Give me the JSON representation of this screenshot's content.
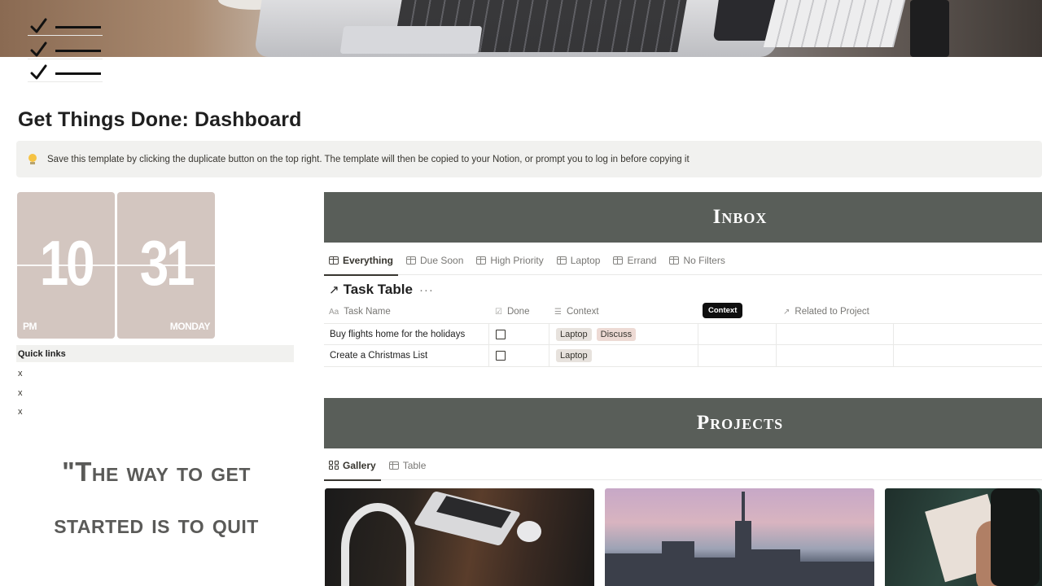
{
  "page": {
    "title": "Get Things Done: Dashboard",
    "callout": "Save this template by clicking the duplicate button on the top right. The template will then be copied to your Notion, or prompt you to log in before copying it"
  },
  "clock": {
    "hour": "10",
    "minute": "31",
    "period": "PM",
    "day": "MONDAY"
  },
  "quick_links": {
    "title": "Quick links",
    "items": [
      "x",
      "x",
      "x"
    ]
  },
  "quote": {
    "text": "\"The way to get started is to quit"
  },
  "inbox": {
    "banner": "Inbox",
    "tabs": [
      "Everything",
      "Due Soon",
      "High Priority",
      "Laptop",
      "Errand",
      "No Filters"
    ],
    "database_title": "Task Table",
    "columns": {
      "task_name": "Task Name",
      "done": "Done",
      "context": "Context",
      "related": "Related to Project"
    },
    "tooltip": "Context",
    "rows": [
      {
        "name": "Buy flights home for the holidays",
        "tags": [
          "Laptop",
          "Discuss"
        ]
      },
      {
        "name": "Create a Christmas List",
        "tags": [
          "Laptop"
        ]
      }
    ]
  },
  "projects": {
    "banner": "Projects",
    "tabs": [
      "Gallery",
      "Table"
    ]
  },
  "colors": {
    "banner": "#595e59",
    "clock_card": "#d3c6c0",
    "callout_bg": "#f1f1ef",
    "tag": "#e7e2dd",
    "tag_discuss": "#eddad4"
  }
}
